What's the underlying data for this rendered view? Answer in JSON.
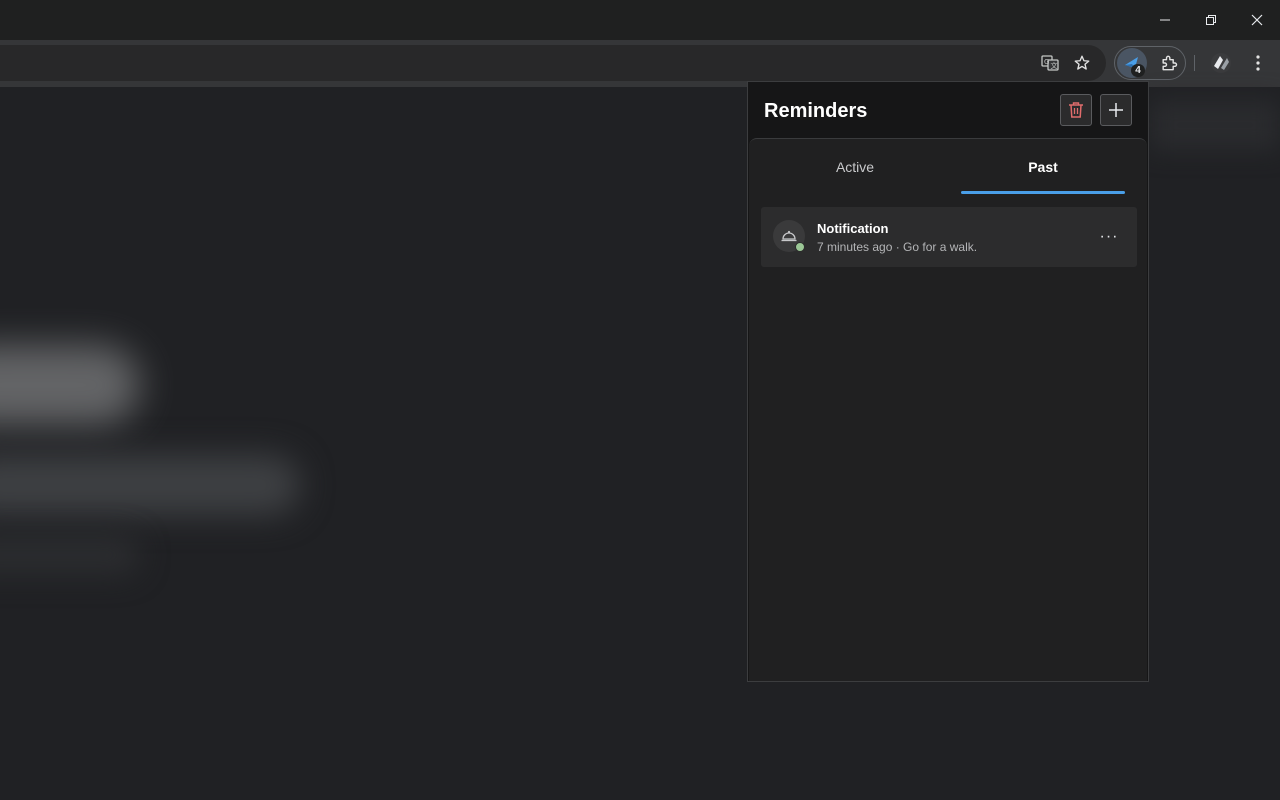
{
  "window": {
    "controls": [
      "minimize-icon",
      "restore-icon",
      "close-icon"
    ]
  },
  "toolbar": {
    "icons": [
      "translate-icon",
      "bookmark-star-icon",
      "reminders-extension-icon",
      "extensions-puzzle-icon",
      "profile-icon",
      "more-vert-icon"
    ],
    "extension_badge": "4"
  },
  "popup": {
    "title": "Reminders",
    "delete_icon": "trash-icon",
    "add_icon": "plus-icon",
    "tabs": [
      {
        "label": "Active",
        "selected": false
      },
      {
        "label": "Past",
        "selected": true
      }
    ],
    "items": [
      {
        "title": "Notification",
        "subtitle": "7 minutes ago · Go for a walk.",
        "icon": "bell-icon",
        "more_label": "···"
      }
    ]
  },
  "colors": {
    "accent": "#4a9fe8",
    "delete": "#e06c6c",
    "status": "#9bc796"
  }
}
